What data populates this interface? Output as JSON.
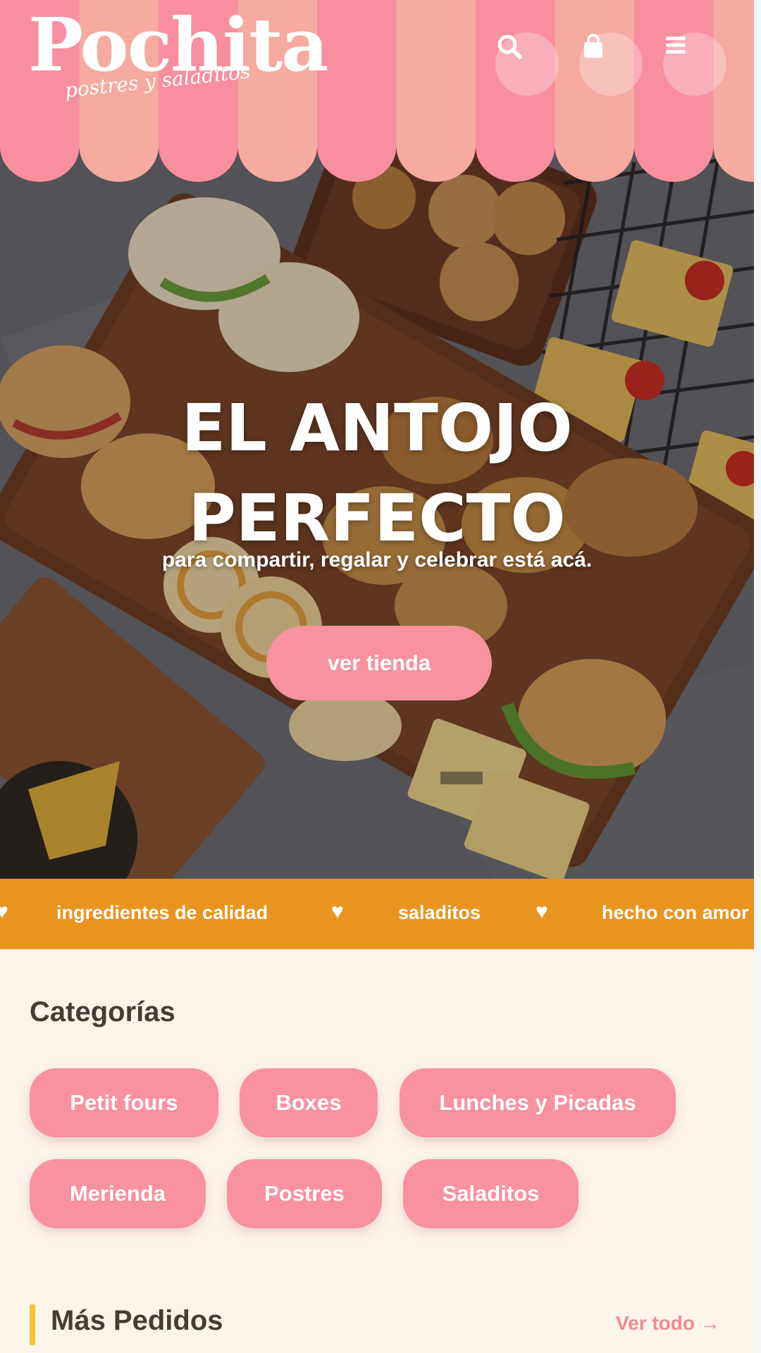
{
  "header": {
    "logo_name": "Pochita",
    "logo_tagline": "postres y saladitos",
    "icons": [
      "search-icon",
      "shopping-bag-icon",
      "menu-icon"
    ]
  },
  "hero": {
    "title_line1": "EL ANTOJO",
    "title_line2": "PERFECTO",
    "subtitle": "para compartir, regalar y celebrar está acá.",
    "cta_label": "ver tienda"
  },
  "ticker": {
    "items": [
      "ingredientes de calidad",
      "saladitos",
      "hecho con amor"
    ],
    "separator": "♥"
  },
  "categories": {
    "title": "Categorías",
    "items": [
      "Petit fours",
      "Boxes",
      "Lunches y Picadas",
      "Merienda",
      "Postres",
      "Saladitos"
    ]
  },
  "mas_pedidos": {
    "title": "Más Pedidos",
    "link": "Ver todo →"
  },
  "colors": {
    "awning_pink": "#f78f9f",
    "awning_peach": "#f6aaa0",
    "button_pink": "#f7929e",
    "ticker_orange": "#e8951f",
    "background_cream": "#fdf4ea",
    "accent_yellow": "#f4c430",
    "link_pink": "#f08a8f",
    "heading_brown": "#4a3a36"
  }
}
